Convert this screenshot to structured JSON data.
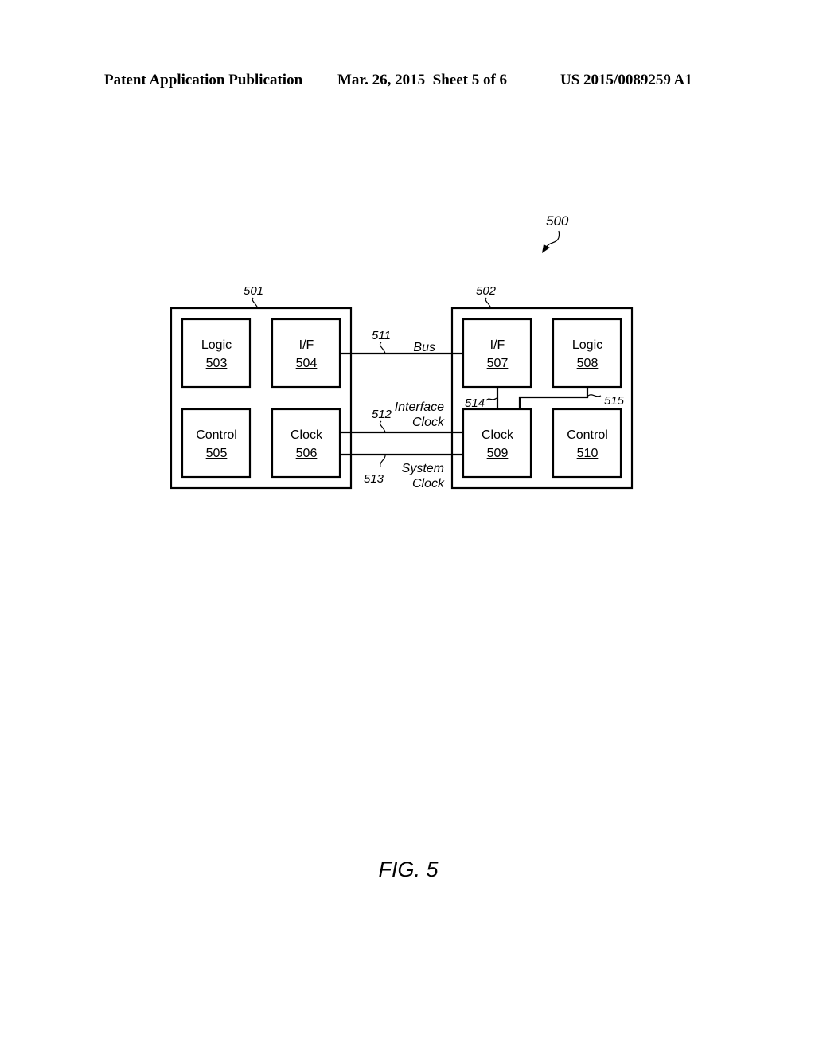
{
  "header": {
    "left": "Patent Application Publication",
    "middle": "Mar. 26, 2015  Sheet 5 of 6",
    "right": "US 2015/0089259 A1"
  },
  "figure": {
    "ref": "500",
    "caption": "FIG. 5",
    "devices": [
      {
        "ref": "501",
        "blocks": [
          {
            "name": "Logic",
            "ref": "503"
          },
          {
            "name": "I/F",
            "ref": "504"
          },
          {
            "name": "Control",
            "ref": "505"
          },
          {
            "name": "Clock",
            "ref": "506"
          }
        ]
      },
      {
        "ref": "502",
        "blocks": [
          {
            "name": "I/F",
            "ref": "507"
          },
          {
            "name": "Logic",
            "ref": "508"
          },
          {
            "name": "Clock",
            "ref": "509"
          },
          {
            "name": "Control",
            "ref": "510"
          }
        ]
      }
    ],
    "connections": [
      {
        "ref": "511",
        "label": "Bus",
        "from": "504",
        "to": "507"
      },
      {
        "ref": "512",
        "label": "Interface Clock",
        "label_line1": "Interface",
        "label_line2": "Clock",
        "from": "506",
        "to": "509"
      },
      {
        "ref": "513",
        "label": "System Clock",
        "label_line1": "System",
        "label_line2": "Clock",
        "from": "506",
        "to": "509"
      },
      {
        "ref": "514",
        "from": "507",
        "to": "509"
      },
      {
        "ref": "515",
        "from": "508",
        "to": "509"
      }
    ]
  }
}
